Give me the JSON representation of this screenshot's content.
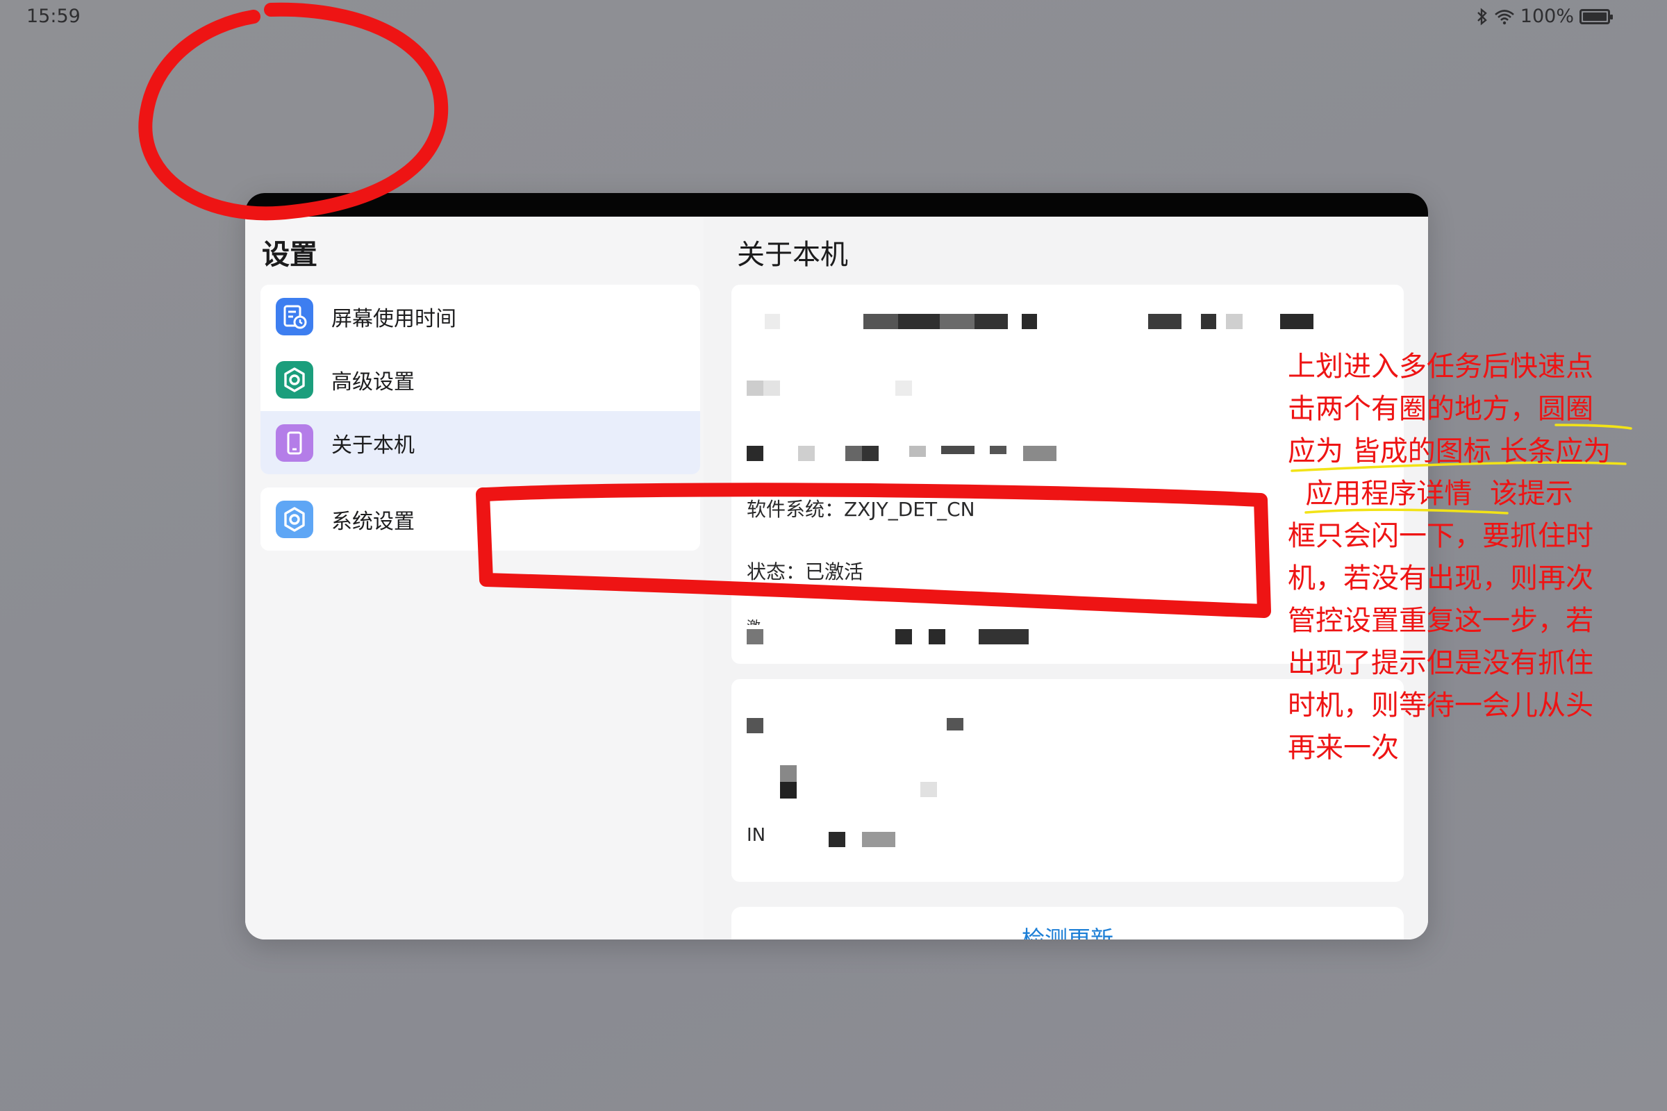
{
  "status_bar": {
    "time": "15:59",
    "battery_percent": "100%"
  },
  "window": {
    "left_title": "设置",
    "right_title": "关于本机",
    "menu_group_1": [
      {
        "label": "屏幕使用时间",
        "icon": "screen-time-icon",
        "color": "#3d7ef0"
      },
      {
        "label": "高级设置",
        "icon": "advanced-settings-gear-icon",
        "color": "#1b9e7c"
      },
      {
        "label": "关于本机",
        "icon": "phone-icon",
        "color": "#b47de8"
      }
    ],
    "menu_group_2": [
      {
        "label": "系统设置",
        "icon": "system-settings-gear-icon",
        "color": "#5ea6f5"
      }
    ],
    "info": {
      "software_system": "软件系统：ZXJY_DET_CN",
      "status": "状态：已激活",
      "partial_row": "激",
      "in_row": "IN"
    },
    "update_button": "检测更新"
  },
  "annotation": {
    "lines": [
      "上划进入多任务后快速点",
      "击两个有圈的地方，圆圈",
      "应为 皆成的图标 长条应为",
      "  应用程序详情  该提示",
      "框只会闪一下，要抓住时",
      "机，若没有出现，则再次",
      "管控设置重复这一步，若",
      "出现了提示但是没有抓住",
      "时机，则等待一会儿从头",
      "再来一次"
    ],
    "ink_color": "#ee1414",
    "highlight_color": "#f2e317"
  }
}
